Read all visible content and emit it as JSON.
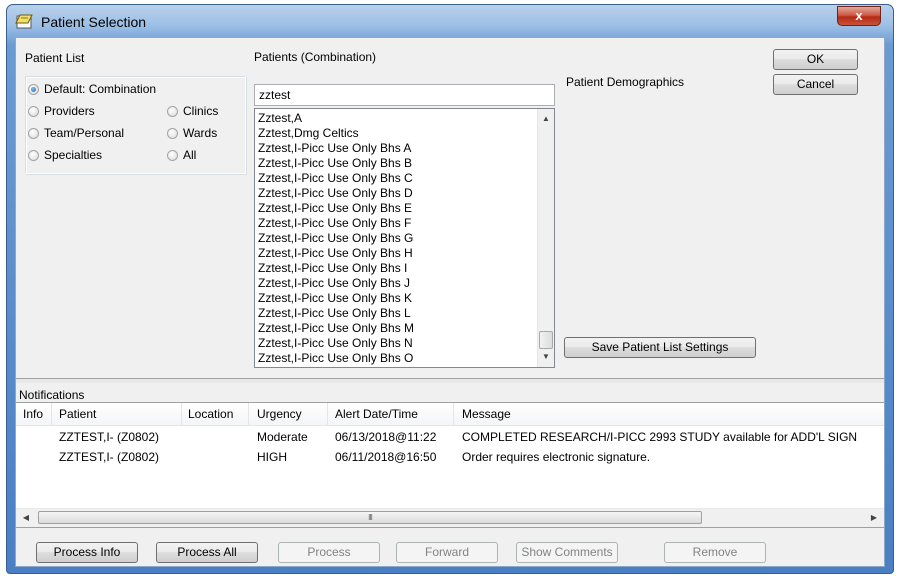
{
  "window": {
    "title": "Patient Selection",
    "close_label": "x"
  },
  "patient_list": {
    "label": "Patient List",
    "options": [
      {
        "label": "Default: Combination",
        "selected": true
      },
      {
        "label": "Providers",
        "selected": false
      },
      {
        "label": "Clinics",
        "selected": false
      },
      {
        "label": "Team/Personal",
        "selected": false
      },
      {
        "label": "Wards",
        "selected": false
      },
      {
        "label": "Specialties",
        "selected": false
      },
      {
        "label": "All",
        "selected": false
      }
    ]
  },
  "patients": {
    "label": "Patients (Combination)",
    "search_value": "zztest",
    "items": [
      "Zztest,A",
      "Zztest,Dmg Celtics",
      "Zztest,I-Picc Use Only Bhs A",
      "Zztest,I-Picc Use Only Bhs B",
      "Zztest,I-Picc Use Only Bhs C",
      "Zztest,I-Picc Use Only Bhs D",
      "Zztest,I-Picc Use Only Bhs E",
      "Zztest,I-Picc Use Only Bhs F",
      "Zztest,I-Picc Use Only Bhs G",
      "Zztest,I-Picc Use Only Bhs H",
      "Zztest,I-Picc Use Only Bhs I",
      "Zztest,I-Picc Use Only Bhs J",
      "Zztest,I-Picc Use Only Bhs K",
      "Zztest,I-Picc Use Only Bhs L",
      "Zztest,I-Picc Use Only Bhs M",
      "Zztest,I-Picc Use Only Bhs N",
      "Zztest,I-Picc Use Only Bhs O"
    ]
  },
  "demographics": {
    "label": "Patient Demographics"
  },
  "buttons": {
    "ok": "OK",
    "cancel": "Cancel",
    "save_settings": "Save Patient List Settings"
  },
  "notifications": {
    "label": "Notifications",
    "columns": [
      "Info",
      "Patient",
      "Location",
      "Urgency",
      "Alert Date/Time",
      "Message"
    ],
    "rows": [
      {
        "info": "",
        "patient": "ZZTEST,I- (Z0802)",
        "location": "",
        "urgency": "Moderate",
        "datetime": "06/13/2018@11:22",
        "message": "COMPLETED RESEARCH/I-PICC 2993 STUDY available for ADD'L SIGN"
      },
      {
        "info": "",
        "patient": "ZZTEST,I- (Z0802)",
        "location": "",
        "urgency": "HIGH",
        "datetime": "06/11/2018@16:50",
        "message": "Order requires electronic signature."
      }
    ],
    "scroll_grip": "III"
  },
  "actions": {
    "process_info": "Process Info",
    "process_all": "Process All",
    "process": "Process",
    "forward": "Forward",
    "show_comments": "Show Comments",
    "remove": "Remove"
  }
}
